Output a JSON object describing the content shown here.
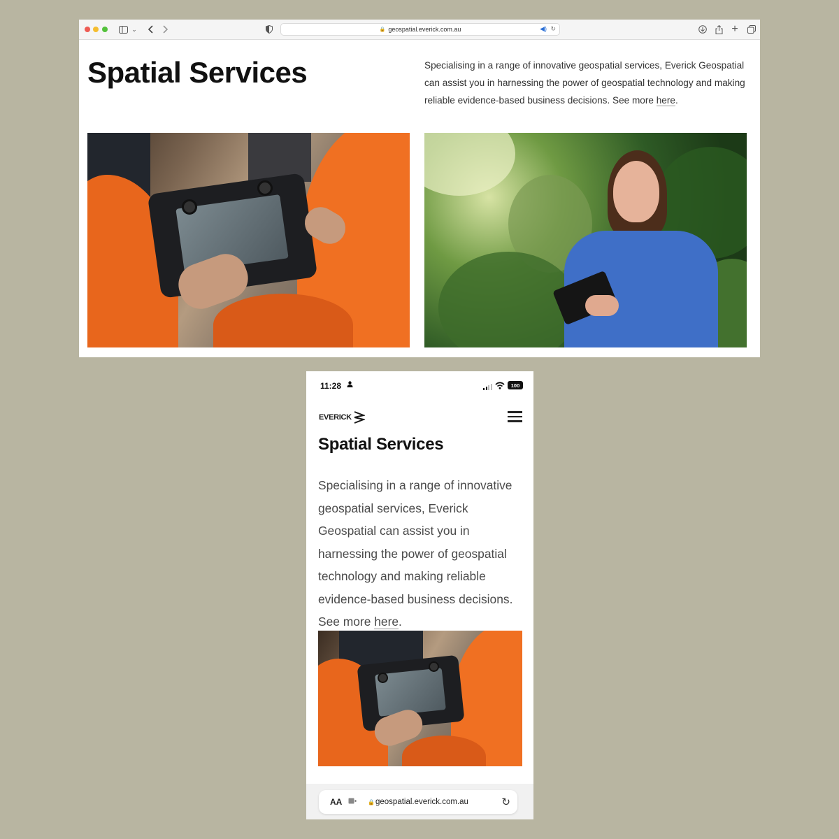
{
  "desktop": {
    "url": "geospatial.everick.com.au",
    "heading": "Spatial Services",
    "description_before_link": "Specialising in a range of innovative geospatial services, Everick Geospatial can assist you in harnessing the power of geospatial technology and making reliable evidence-based business decisions. See more ",
    "link_text": "here",
    "description_after_link": ".",
    "toolbar_icons": [
      "sidebar-icon",
      "chevron-down-icon",
      "back-arrow-icon",
      "forward-arrow-icon",
      "shield-icon",
      "lock-icon",
      "audio-icon",
      "reload-icon",
      "download-icon",
      "share-icon",
      "plus-icon",
      "tabs-icon"
    ],
    "images": [
      "drone-controller-photo",
      "surveyor-with-tablet-photo"
    ]
  },
  "mobile": {
    "time": "11:28",
    "battery": "100",
    "logo": "EVERICK",
    "heading": "Spatial Services",
    "description_before_link": "Specialising in a range of innovative geospatial services, Everick Geospatial can assist you in harnessing the power of geospatial technology and making reliable evidence-based business decisions. See more ",
    "link_text": "here",
    "description_after_link": ".",
    "text_size_label": "AA",
    "url": "geospatial.everick.com.au",
    "images": [
      "drone-controller-photo"
    ]
  },
  "colors": {
    "background": "#b8b5a1",
    "hi_vis_orange": "#e8661c",
    "shirt_blue": "#3f6fc7"
  }
}
